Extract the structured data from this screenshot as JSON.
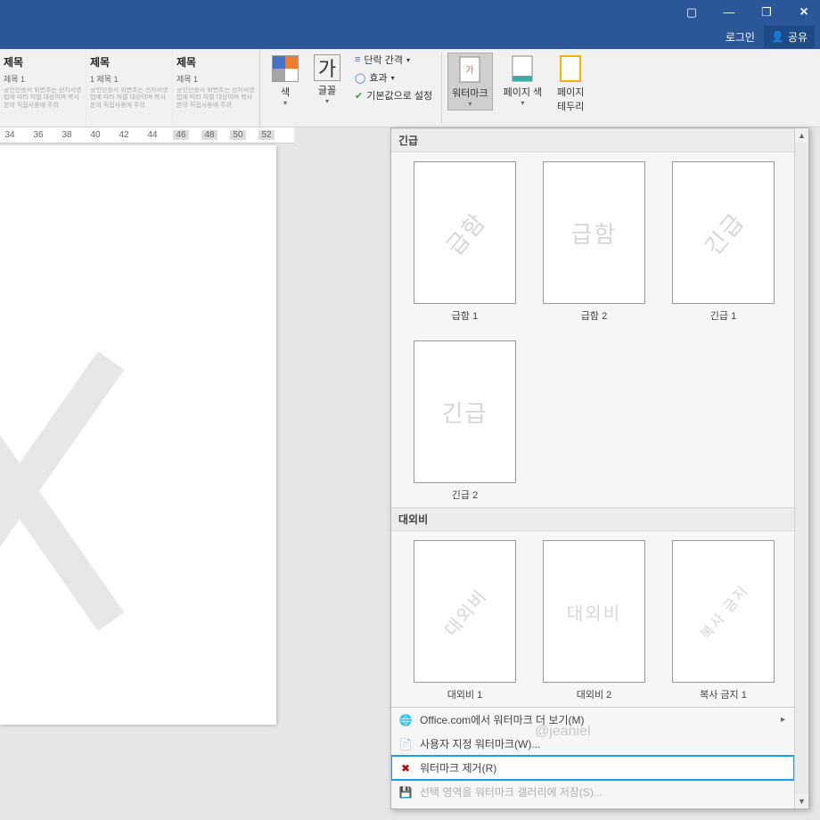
{
  "titlebar": {
    "login": "로그인",
    "share": "공유"
  },
  "ribbon": {
    "styles": [
      {
        "title": "제목",
        "sub": "제목 1",
        "lorem": "공인인증서 위변조는 전자서명법에 따라 처벌 대상이며 복사본의 직접사용에 주의"
      },
      {
        "title": "제목",
        "sub": "1 제목 1",
        "lorem": "공인인증서 위변조는 전자서명법에 따라 처벌 대상이며 복사본의 직접사용에 주의"
      },
      {
        "title": "제목",
        "sub": "제목 1",
        "lorem": "공인인증서 위변조는 전자서명법에 따라 처벌 대상이며 복사본의 직접사용에 주의"
      }
    ],
    "color": "색",
    "font": "글꼴",
    "font_char": "가",
    "para_spacing": "단락 간격",
    "effects": "효과",
    "set_default": "기본값으로 설정",
    "watermark": "워터마크",
    "page_color": "페이지 색",
    "page_border": "페이지\n테두리"
  },
  "ruler": [
    "34",
    "36",
    "38",
    "40",
    "42",
    "44",
    "46",
    "48",
    "50",
    "52"
  ],
  "dropdown": {
    "group1": "긴급",
    "group2": "대외비",
    "items1": [
      {
        "text": "급함",
        "diag": true,
        "label": "급함 1"
      },
      {
        "text": "급함",
        "diag": false,
        "label": "급함 2"
      },
      {
        "text": "긴급",
        "diag": true,
        "label": "긴급 1"
      },
      {
        "text": "긴급",
        "diag": false,
        "label": "긴급 2"
      }
    ],
    "items2_partial": [
      {
        "text": "대외비",
        "diag": true,
        "label": "대외비 1"
      },
      {
        "text": "대외비",
        "diag": false,
        "label": "대외비 2"
      },
      {
        "text": "복사 금지",
        "diag": true,
        "label": "복사 금지 1"
      }
    ],
    "menu": {
      "more_office": "Office.com에서 워터마크 더 보기(M)",
      "custom": "사용자 지정 워터마크(W)...",
      "remove": "워터마크 제거(R)",
      "save_selection": "선택 영역을 워터마크 갤러리에 저장(S)..."
    }
  },
  "author": "@jeaniel"
}
